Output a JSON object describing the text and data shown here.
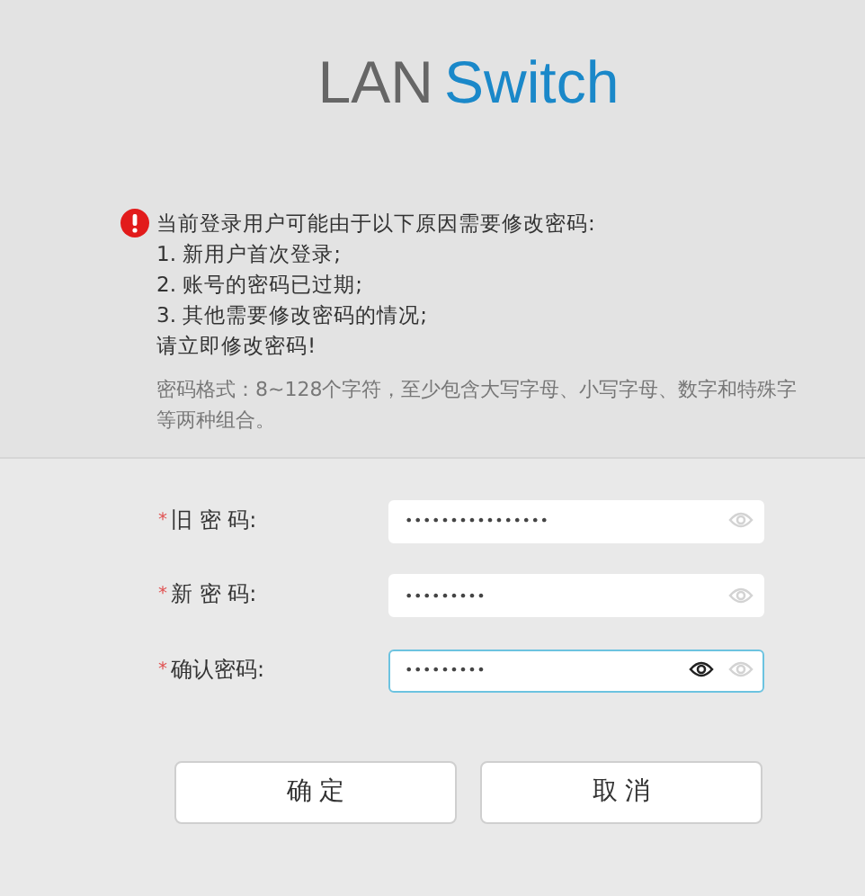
{
  "logo": {
    "part_1": "LAN",
    "part_2": "Switch"
  },
  "notice": {
    "title": "当前登录用户可能由于以下原因需要修改密码:",
    "lines": [
      "1. 新用户首次登录;",
      "2. 账号的密码已过期;",
      "3. 其他需要修改密码的情况;",
      "请立即修改密码!"
    ],
    "format": [
      "密码格式：8~128个字符，至少包含大写字母、小写字母、数字和特殊字",
      "等两种组合。"
    ]
  },
  "fields": [
    {
      "required_mark": "*",
      "label": "旧 密 码:",
      "value": "••••••••••••••••",
      "focused": false
    },
    {
      "required_mark": "*",
      "label": "新 密 码:",
      "value": "•••••••••",
      "focused": false
    },
    {
      "required_mark": "*",
      "label": "确认密码:",
      "value": "•••••••••",
      "focused": true
    }
  ],
  "buttons": [
    "确 定",
    "取 消"
  ]
}
